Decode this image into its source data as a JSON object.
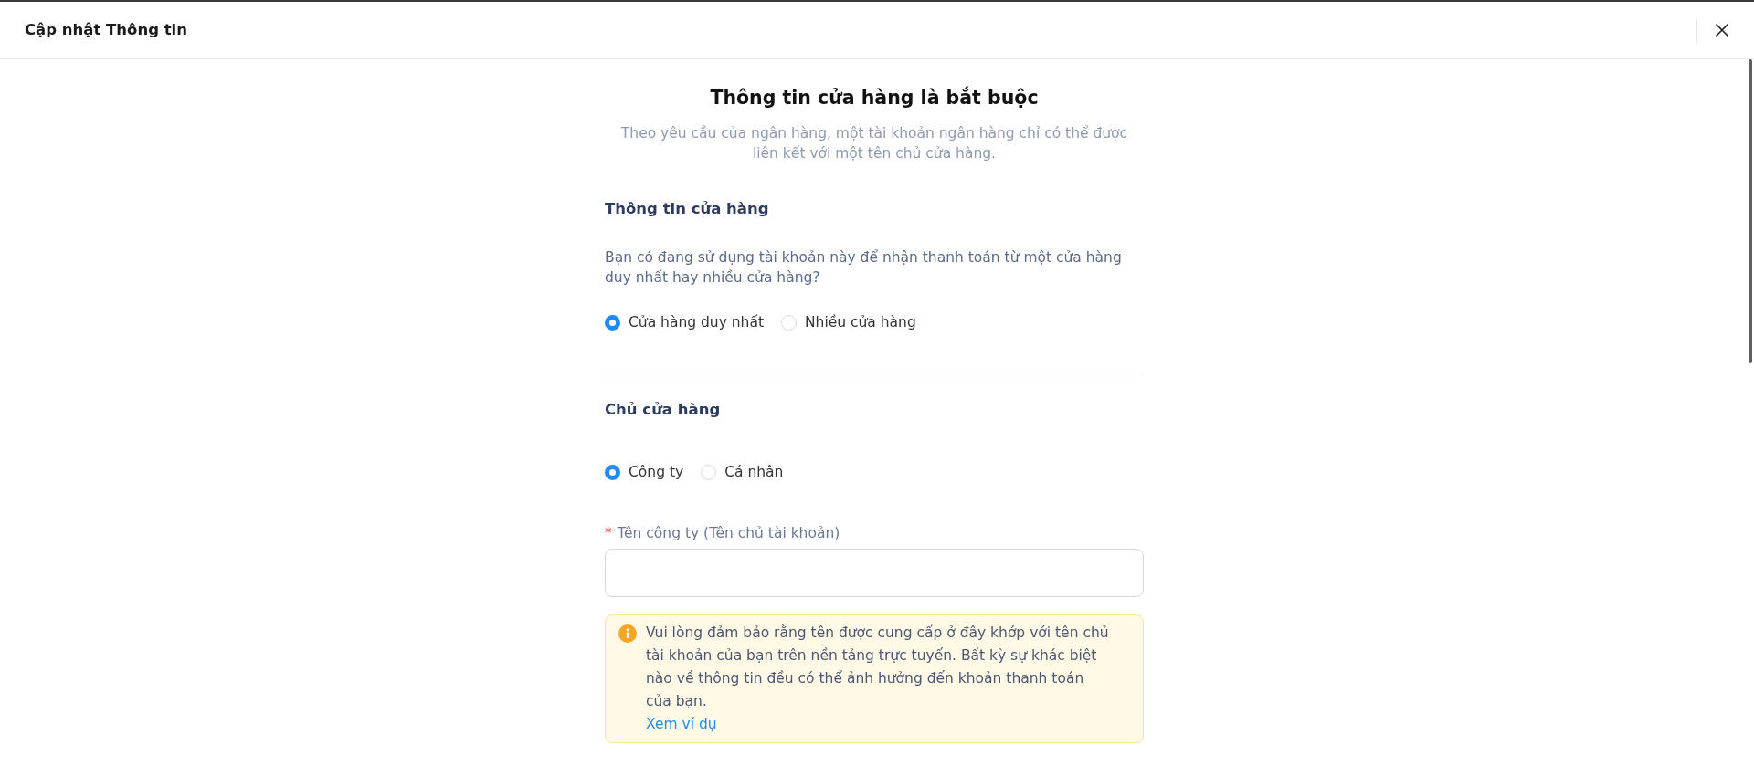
{
  "dialog": {
    "title": "Cập nhật Thông tin"
  },
  "heading": "Thông tin cửa hàng là bắt buộc",
  "subtitle": "Theo yêu cầu của ngân hàng, một tài khoản ngân hàng chỉ có thể được liên kết với một tên chủ cửa hàng.",
  "sections": [
    {
      "title": "Thông tin cửa hàng",
      "question": "Bạn có đang sử dụng tài khoản này để nhận thanh toán từ một cửa hàng duy nhất hay nhiều cửa hàng?",
      "options": [
        {
          "label": "Cửa hàng duy nhất",
          "selected": true
        },
        {
          "label": "Nhiều cửa hàng",
          "selected": false
        }
      ]
    },
    {
      "title": "Chủ cửa hàng",
      "options": [
        {
          "label": "Công ty",
          "selected": true
        },
        {
          "label": "Cá nhân",
          "selected": false
        }
      ],
      "field": {
        "required_mark": "*",
        "label": "Tên công ty (Tên chủ tài khoản)"
      },
      "notice": {
        "text": "Vui lòng đảm bảo rằng tên được cung cấp ở đây khớp với tên chủ tài khoản của bạn trên nền tảng trực tuyến. Bất kỳ sự khác biệt nào về thông tin đều có thể ảnh hưởng đến khoản thanh toán của bạn.",
        "link": "Xem ví dụ"
      }
    }
  ]
}
